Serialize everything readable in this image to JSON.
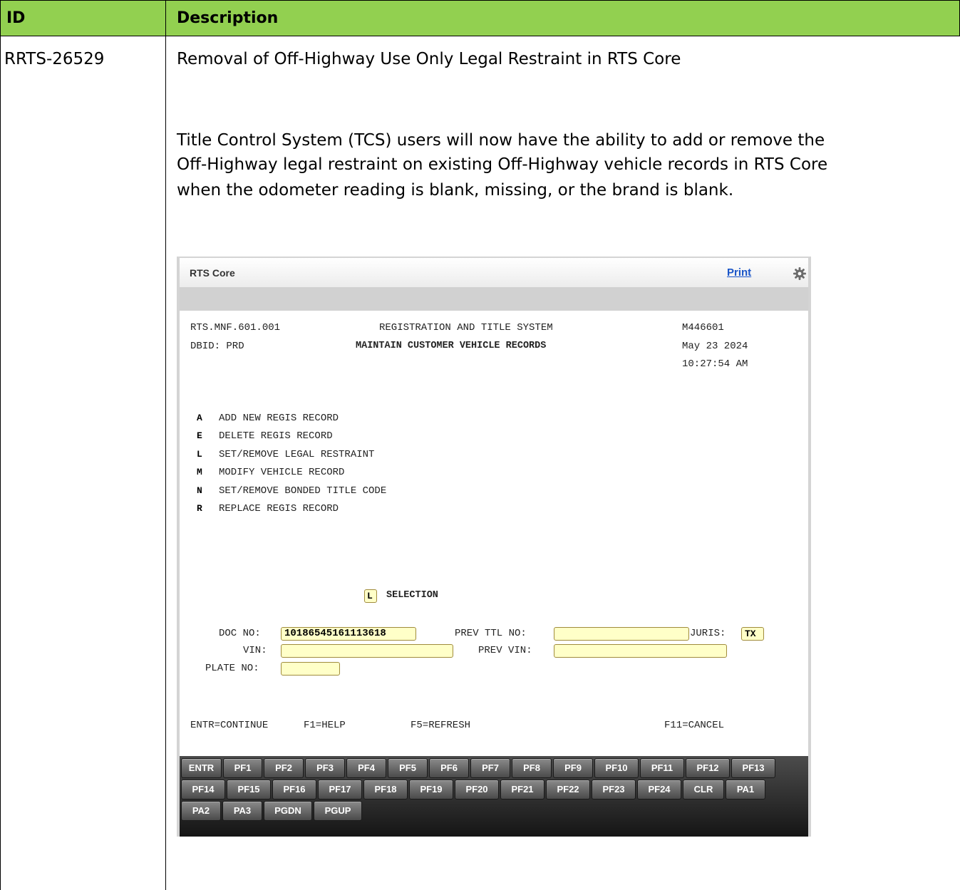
{
  "table": {
    "headers": {
      "id": "ID",
      "description": "Description"
    },
    "row": {
      "id": "RRTS-26529",
      "title": "Removal of Off-Highway Use Only Legal Restraint in RTS Core",
      "paragraph_lines": [
        "Title Control System (TCS) users will now have the ability to add or remove the",
        "Off-Highway legal restraint on existing Off-Highway vehicle records in RTS Core",
        "when the odometer reading is blank, missing, or the brand is blank."
      ]
    }
  },
  "colors": {
    "header_bg": "#92d050",
    "field_bg": "#ffffc8",
    "link": "#1a55c8"
  },
  "rts_window": {
    "title": "RTS Core",
    "print_link": "Print",
    "settings_icon": "gear-icon",
    "screen": {
      "program_id": "RTS.MNF.601.001",
      "system_title": "REGISTRATION AND TITLE SYSTEM",
      "user_id": "M446601",
      "dbid": "DBID: PRD",
      "screen_title": "MAINTAIN CUSTOMER VEHICLE RECORDS",
      "date": "May 23 2024",
      "time": "10:27:54 AM",
      "menu": [
        {
          "key": "A",
          "label": "ADD NEW REGIS RECORD"
        },
        {
          "key": "E",
          "label": "DELETE REGIS RECORD"
        },
        {
          "key": "L",
          "label": "SET/REMOVE LEGAL RESTRAINT"
        },
        {
          "key": "M",
          "label": "MODIFY VEHICLE RECORD"
        },
        {
          "key": "N",
          "label": "SET/REMOVE BONDED TITLE CODE"
        },
        {
          "key": "R",
          "label": "REPLACE REGIS RECORD"
        }
      ],
      "selection": {
        "value": "L",
        "label": "SELECTION"
      },
      "fields": {
        "doc_no": {
          "label": "DOC NO:",
          "value": "10186545161113618"
        },
        "prev_ttl_no": {
          "label": "PREV TTL NO:",
          "value": ""
        },
        "juris": {
          "label": "JURIS:",
          "value": "TX"
        },
        "vin": {
          "label": "VIN:",
          "value": ""
        },
        "prev_vin": {
          "label": "PREV VIN:",
          "value": ""
        },
        "plate_no": {
          "label": "PLATE NO:",
          "value": ""
        }
      },
      "fkeys": {
        "continue": "ENTR=CONTINUE",
        "help": "F1=HELP",
        "refresh": "F5=REFRESH",
        "cancel": "F11=CANCEL"
      }
    },
    "key_rows": [
      [
        "ENTR",
        "PF1",
        "PF2",
        "PF3",
        "PF4",
        "PF5",
        "PF6",
        "PF7",
        "PF8",
        "PF9",
        "PF10",
        "PF11",
        "PF12",
        "PF13"
      ],
      [
        "PF14",
        "PF15",
        "PF16",
        "PF17",
        "PF18",
        "PF19",
        "PF20",
        "PF21",
        "PF22",
        "PF23",
        "PF24",
        "CLR",
        "PA1"
      ],
      [
        "PA2",
        "PA3",
        "PGDN",
        "PGUP"
      ]
    ]
  }
}
